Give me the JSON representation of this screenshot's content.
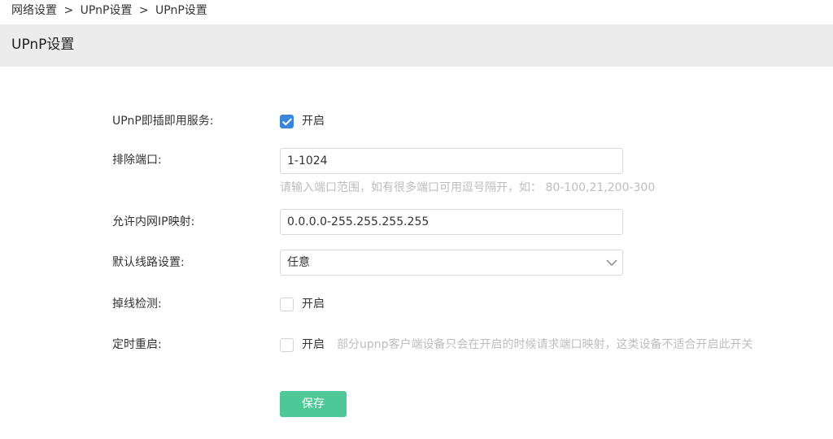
{
  "breadcrumb": {
    "items": [
      "网络设置",
      "UPnP设置",
      "UPnP设置"
    ],
    "separator": ">"
  },
  "page": {
    "title": "UPnP设置"
  },
  "form": {
    "upnp": {
      "label": "UPnP即插即用服务:",
      "option_label": "开启",
      "checked": true
    },
    "exclude_ports": {
      "label": "排除端口:",
      "value": "1-1024",
      "hint": "请输入端口范围，如有很多端口可用逗号隔开，如：  80-100,21,200-300"
    },
    "allow_ip": {
      "label": "允许内网IP映射:",
      "value": "0.0.0.0-255.255.255.255"
    },
    "default_line": {
      "label": "默认线路设置:",
      "selected": "任意"
    },
    "offline_detect": {
      "label": "掉线检测:",
      "option_label": "开启",
      "checked": false
    },
    "scheduled_restart": {
      "label": "定时重启:",
      "option_label": "开启",
      "checked": false,
      "note": "部分upnp客户端设备只会在开启的时候请求端口映射，这类设备不适合开启此开关"
    },
    "save_label": "保存"
  },
  "colors": {
    "accent_checkbox": "#3a86d8",
    "save_button": "#4fc897",
    "title_bar_bg": "#ececec",
    "hint_text": "#bdbdbd"
  }
}
